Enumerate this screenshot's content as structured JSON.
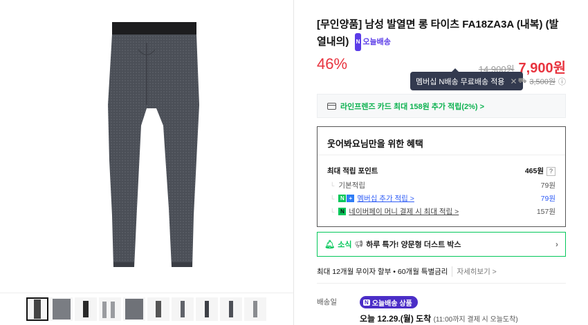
{
  "product": {
    "title": "[무인양품] 남성 발열면 롱 타이츠 FA18ZA3A (내복) (발열내의)",
    "today_badge": "오늘배송",
    "today_badge_icon": "N"
  },
  "pricing": {
    "discount": "46%",
    "original_price": "14,900원",
    "sale_price": "7,900원"
  },
  "tooltip": {
    "text": "멤버십 N배송 무료배송 적용"
  },
  "shipping_fee": {
    "icon": "truck-icon",
    "amount": "3,500원"
  },
  "card_banner": {
    "text": "라인프렌즈 카드 최대 158원 추가 적립(2%) >"
  },
  "benefits": {
    "title": "웃어봐요님만을 위한 혜택",
    "max_points_label": "최대 적립 포인트",
    "max_points_value": "465원",
    "help": "?",
    "rows": [
      {
        "label": "기본적립",
        "value": "79원"
      },
      {
        "label": "멤버십 추가 적립 >",
        "value": "79원"
      },
      {
        "label": "네이버페이 머니 결제 시 최대 적립 >",
        "value": "157원"
      }
    ]
  },
  "news": {
    "label": "소식",
    "text": "하루 특가! 양문형 더스트 박스"
  },
  "installment": {
    "text": "최대 12개월 무이자 할부 • 60개월 특별금리",
    "more": "자세히보기 >"
  },
  "delivery": {
    "label": "배송일",
    "badge": "오늘배송 상품",
    "date": "오늘 12.29.(월) 도착",
    "note": "(11:00까지 결제 시 오늘도착)"
  },
  "colors": {
    "accent_red": "#e8343f",
    "naver_green": "#03c75a",
    "today_purple": "#5b3ce8"
  },
  "thumbnails": [
    {
      "name": "thumb-1",
      "active": true
    },
    {
      "name": "thumb-2",
      "active": false
    },
    {
      "name": "thumb-3",
      "active": false
    },
    {
      "name": "thumb-4",
      "active": false
    },
    {
      "name": "thumb-5",
      "active": false
    },
    {
      "name": "thumb-6",
      "active": false
    },
    {
      "name": "thumb-7",
      "active": false
    },
    {
      "name": "thumb-8",
      "active": false
    },
    {
      "name": "thumb-9",
      "active": false
    },
    {
      "name": "thumb-10",
      "active": false
    }
  ]
}
